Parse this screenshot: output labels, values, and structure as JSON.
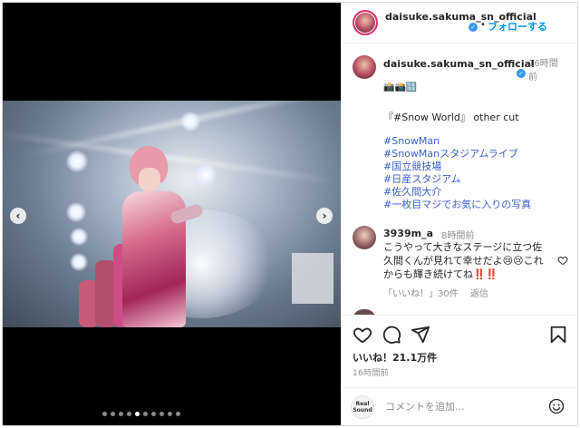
{
  "header": {
    "username": "daisuke.sakuma_sn_official",
    "separator": "•",
    "follow_label": "フォローする"
  },
  "caption": {
    "username": "daisuke.sakuma_sn_official",
    "time": "16時間前",
    "emoji": "📸📸🔢",
    "lines": [
      "『#Snow World』 other cut",
      "#SnowMan",
      "#SnowManスタジアムライブ",
      "#国立競技場",
      "#日産スタジアム",
      "#佐久間大介",
      "#一枚目マジでお気に入りの写真"
    ]
  },
  "comment": {
    "username": "3939m_a",
    "time": "8時間前",
    "text": "こうやって大きなステージに立つ佐久間くんが見れて幸せだよ😢😢これからも輝き続けてね",
    "exclaim": "‼️‼️",
    "likes_label": "「いいね！」30件",
    "reply_label": "返信"
  },
  "actions": {
    "likes": "いいね！21.1万件",
    "posted": "16時間前"
  },
  "comment_box": {
    "placeholder": "コメントを追加...",
    "watermark": "Real Sound"
  },
  "carousel": {
    "slides": 10,
    "active_index": 4
  },
  "icons": [
    "chevron-left-icon",
    "chevron-right-icon",
    "verified-icon",
    "heart-icon",
    "comment-icon",
    "share-icon",
    "emoji-icon"
  ]
}
